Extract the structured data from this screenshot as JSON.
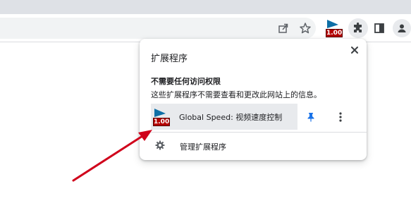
{
  "toolbar": {
    "icons": [
      "share-icon",
      "bookmark-star-icon",
      "speed-extension-icon",
      "extensions-puzzle-icon",
      "side-panel-icon",
      "profile-icon"
    ],
    "extension_badge": "1.00"
  },
  "popup": {
    "title": "扩展程序",
    "section_title": "不需要任何访问权限",
    "section_desc": "这些扩展程序不需要查看和更改此网站上的信息。",
    "extension": {
      "name": "Global Speed: 视频速度控制",
      "badge": "1.00"
    },
    "manage_label": "管理扩展程序"
  },
  "colors": {
    "arrow": "#d0021b",
    "pin": "#1a73e8",
    "badge": "#b30000",
    "flag": "#0e6fa6"
  }
}
